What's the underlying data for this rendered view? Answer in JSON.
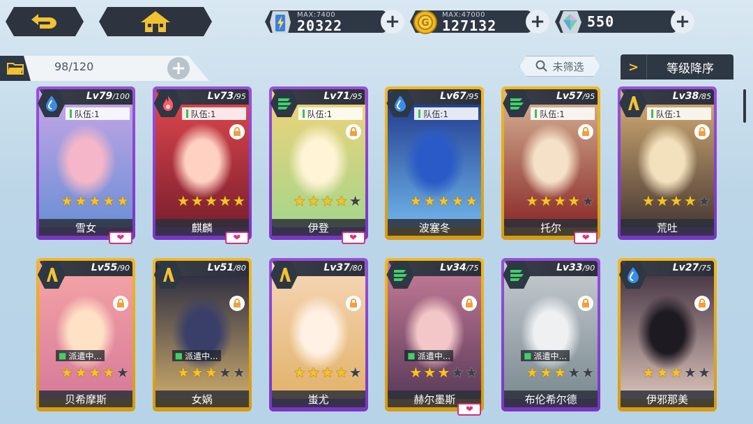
{
  "topbar": {
    "back_icon": "undo-arrow-icon",
    "home_icon": "home-icon",
    "resources": [
      {
        "icon": "stamina-battery-icon",
        "max_label": "MAX:7400",
        "value": "20322"
      },
      {
        "icon": "gold-coin-icon",
        "max_label": "MAX:47000",
        "value": "127132"
      },
      {
        "icon": "gem-crystal-icon",
        "max_label": "",
        "value": "550"
      }
    ],
    "plus_label": "+"
  },
  "subbar": {
    "count": "98/120",
    "filter_label": "未筛选",
    "sort_label": "等级降序",
    "sort_chevron": ">"
  },
  "labels": {
    "team": "队伍:1",
    "dispatch": "派遣中..."
  },
  "cards": [
    {
      "name": "雪女",
      "lv": "Lv79",
      "max": "/100",
      "element": "water-drop-icon",
      "rarity": "purple",
      "stars": 5,
      "team": true,
      "heart": true,
      "dispatch": false,
      "art": [
        "#f4b6c8",
        "#c9a7e6",
        "#6c8fd6"
      ]
    },
    {
      "name": "麒麟",
      "lv": "Lv73",
      "max": "/95",
      "element": "fire-icon",
      "rarity": "purple",
      "stars": 5,
      "team": true,
      "heart": true,
      "dispatch": false,
      "art": [
        "#ffd1c2",
        "#e5494f",
        "#7b1f2e"
      ]
    },
    {
      "name": "伊登",
      "lv": "Lv71",
      "max": "/95",
      "element": "wind-icon",
      "rarity": "purple",
      "stars": 4,
      "team": true,
      "heart": true,
      "dispatch": false,
      "art": [
        "#fff4d6",
        "#f2d27a",
        "#a6d68a"
      ]
    },
    {
      "name": "波塞冬",
      "lv": "Lv67",
      "max": "/95",
      "element": "water-drop-icon",
      "rarity": "gold",
      "stars": 5,
      "team": true,
      "heart": false,
      "dispatch": false,
      "art": [
        "#2a5ac7",
        "#1a2f86",
        "#6fb5e9"
      ]
    },
    {
      "name": "托尔",
      "lv": "Lv57",
      "max": "/95",
      "element": "wind-icon",
      "rarity": "gold",
      "stars": 4,
      "team": true,
      "heart": true,
      "dispatch": false,
      "art": [
        "#f5e0c8",
        "#d9b999",
        "#8a2a2a"
      ]
    },
    {
      "name": "荒吐",
      "lv": "Lv38",
      "max": "/85",
      "element": "earth-icon",
      "rarity": "purple",
      "stars": 4,
      "team": true,
      "heart": false,
      "dispatch": false,
      "art": [
        "#f3e1bd",
        "#d9b378",
        "#4a3a35"
      ]
    },
    {
      "name": "贝希摩斯",
      "lv": "Lv55",
      "max": "/90",
      "element": "earth-icon",
      "rarity": "gold",
      "stars": 4,
      "team": false,
      "heart": false,
      "dispatch": true,
      "art": [
        "#ffe2c6",
        "#f6a6a6",
        "#d77a9a"
      ]
    },
    {
      "name": "女娲",
      "lv": "Lv51",
      "max": "/80",
      "element": "earth-icon",
      "rarity": "gold",
      "stars": 3,
      "team": false,
      "heart": false,
      "dispatch": true,
      "art": [
        "#3a3f6a",
        "#1e223e",
        "#c9a86a"
      ]
    },
    {
      "name": "蚩尤",
      "lv": "Lv37",
      "max": "/80",
      "element": "earth-icon",
      "rarity": "purple",
      "stars": 4,
      "team": false,
      "heart": false,
      "dispatch": false,
      "art": [
        "#fff1e4",
        "#f6d7b9",
        "#e2b26a"
      ]
    },
    {
      "name": "赫尔墨斯",
      "lv": "Lv34",
      "max": "/75",
      "element": "wind-icon",
      "rarity": "gold",
      "stars": 3,
      "team": false,
      "heart": true,
      "dispatch": true,
      "art": [
        "#f3c7c7",
        "#c97d99",
        "#5a3b5a"
      ]
    },
    {
      "name": "布伦希尔德",
      "lv": "Lv33",
      "max": "/90",
      "element": "wind-icon",
      "rarity": "purple",
      "stars": 3,
      "team": false,
      "heart": false,
      "dispatch": true,
      "art": [
        "#eef0f2",
        "#c8cdd2",
        "#7b8a91"
      ]
    },
    {
      "name": "伊邪那美",
      "lv": "Lv27",
      "max": "/75",
      "element": "water-drop-icon",
      "rarity": "gold",
      "stars": 3,
      "team": false,
      "heart": false,
      "dispatch": false,
      "art": [
        "#1e1a22",
        "#3a2a3a",
        "#d9c0b8"
      ]
    }
  ]
}
